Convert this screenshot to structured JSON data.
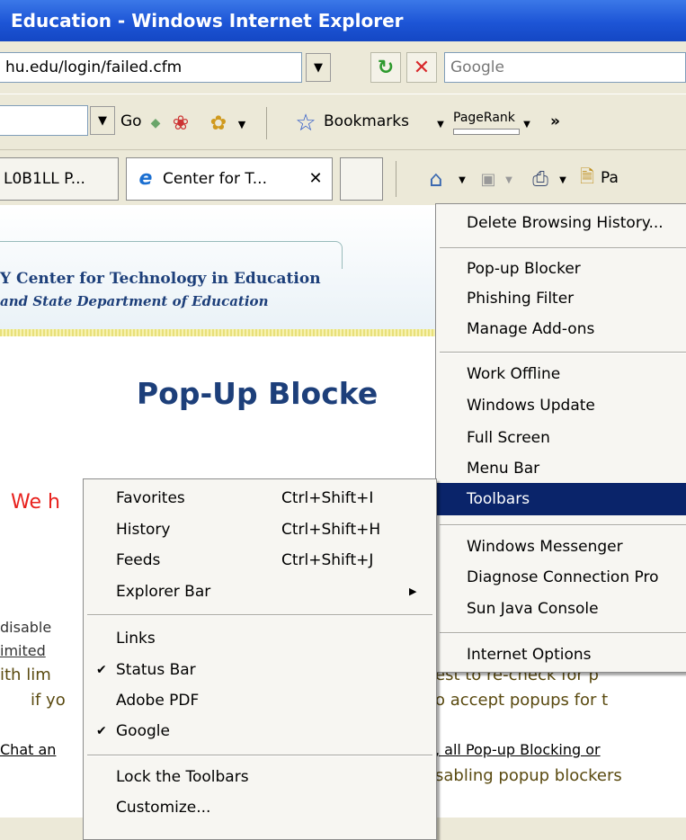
{
  "window": {
    "title": "Education - Windows Internet Explorer"
  },
  "address": {
    "url": "hu.edu/login/failed.cfm",
    "search_placeholder": "Google"
  },
  "toolbar": {
    "go_label": "Go",
    "bookmarks_label": "Bookmarks",
    "pagerank_label": "PageRank",
    "more_glyph": "»"
  },
  "tabs": [
    {
      "label": "L0B1LL P..."
    },
    {
      "label": "Center for T..."
    }
  ],
  "command_bar": {
    "page_label": "Pa"
  },
  "page": {
    "banner_line1": "Y Center for Technology in Education",
    "banner_line2": "and State Department of Education",
    "heading": "Pop-Up Blocke",
    "red_text": "We h",
    "lines": [
      {
        "left": "disable",
        "right": ""
      },
      {
        "left": "imited",
        "right": ""
      },
      {
        "left": "ith lim",
        "right": "est to re-check for p"
      },
      {
        "left": "if yo",
        "right": "o accept popups for t"
      },
      {
        "left": "Chat an",
        "right": ", all Pop-up Blocking or"
      },
      {
        "left": "",
        "right": "sabling popup blockers"
      }
    ]
  },
  "tools_menu": {
    "items": [
      {
        "label": "Delete Browsing History..."
      },
      {
        "label": "Pop-up Blocker"
      },
      {
        "label": "Phishing Filter"
      },
      {
        "label": "Manage Add-ons"
      },
      {
        "label": "Work Offline"
      },
      {
        "label": "Windows Update"
      },
      {
        "label": "Full Screen"
      },
      {
        "label": "Menu Bar"
      },
      {
        "label": "Toolbars"
      },
      {
        "label": "Windows Messenger"
      },
      {
        "label": "Diagnose Connection Pro"
      },
      {
        "label": "Sun Java Console"
      },
      {
        "label": "Internet Options"
      }
    ]
  },
  "toolbars_menu": {
    "items": [
      {
        "label": "Favorites",
        "shortcut": "Ctrl+Shift+I"
      },
      {
        "label": "History",
        "shortcut": "Ctrl+Shift+H"
      },
      {
        "label": "Feeds",
        "shortcut": "Ctrl+Shift+J"
      },
      {
        "label": "Explorer Bar",
        "shortcut": ""
      },
      {
        "label": "Links",
        "shortcut": ""
      },
      {
        "label": "Status Bar",
        "shortcut": "",
        "checked": true
      },
      {
        "label": "Adobe PDF",
        "shortcut": ""
      },
      {
        "label": "Google",
        "shortcut": "",
        "checked": true
      },
      {
        "label": "Lock the Toolbars",
        "shortcut": ""
      },
      {
        "label": "Customize...",
        "shortcut": ""
      }
    ],
    "check_glyph": "✔",
    "submenu_glyph": "▶"
  },
  "colors": {
    "menu_highlight": "#0a246a",
    "red_text": "#e8211d",
    "heading": "#1d3f7a",
    "link": "#5a4a10"
  }
}
